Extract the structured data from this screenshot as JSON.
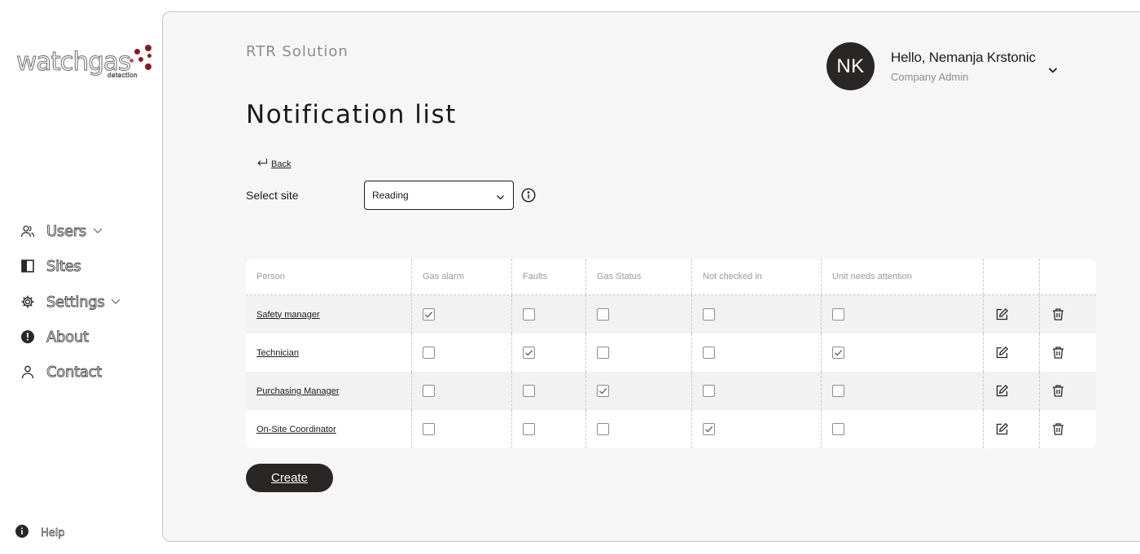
{
  "brand": {
    "logo_text": "watchgas",
    "logo_sub": "detection",
    "accent": "#8a1a22"
  },
  "sidebar": {
    "items": [
      {
        "label": "Users",
        "icon": "users-icon",
        "has_caret": true
      },
      {
        "label": "Sites",
        "icon": "sites-icon",
        "has_caret": false
      },
      {
        "label": "Settings",
        "icon": "gear-icon",
        "has_caret": true
      },
      {
        "label": "About",
        "icon": "alert-icon",
        "has_caret": false
      },
      {
        "label": "Contact",
        "icon": "person-icon",
        "has_caret": false
      }
    ],
    "help_label": "Help"
  },
  "header": {
    "company": "RTR Solution",
    "title": "Notification list",
    "user": {
      "initials": "NK",
      "greeting": "Hello, Nemanja Krstonic",
      "role": "Company Admin"
    }
  },
  "back_label": "Back",
  "site": {
    "label": "Select site",
    "selected": "Reading"
  },
  "table": {
    "columns": [
      "Person",
      "Gas alarm",
      "Faults",
      "Gas Status",
      "Not checked in",
      "Unit needs attention",
      "",
      ""
    ],
    "rows": [
      {
        "person": "Safety manager",
        "checks": [
          true,
          false,
          false,
          false,
          false
        ]
      },
      {
        "person": "Technician",
        "checks": [
          false,
          true,
          false,
          false,
          true
        ]
      },
      {
        "person": "Purchasing Manager",
        "checks": [
          false,
          false,
          true,
          false,
          false
        ]
      },
      {
        "person": "On-Site Coordinator",
        "checks": [
          false,
          false,
          false,
          true,
          false
        ]
      }
    ]
  },
  "create_label": "Create"
}
